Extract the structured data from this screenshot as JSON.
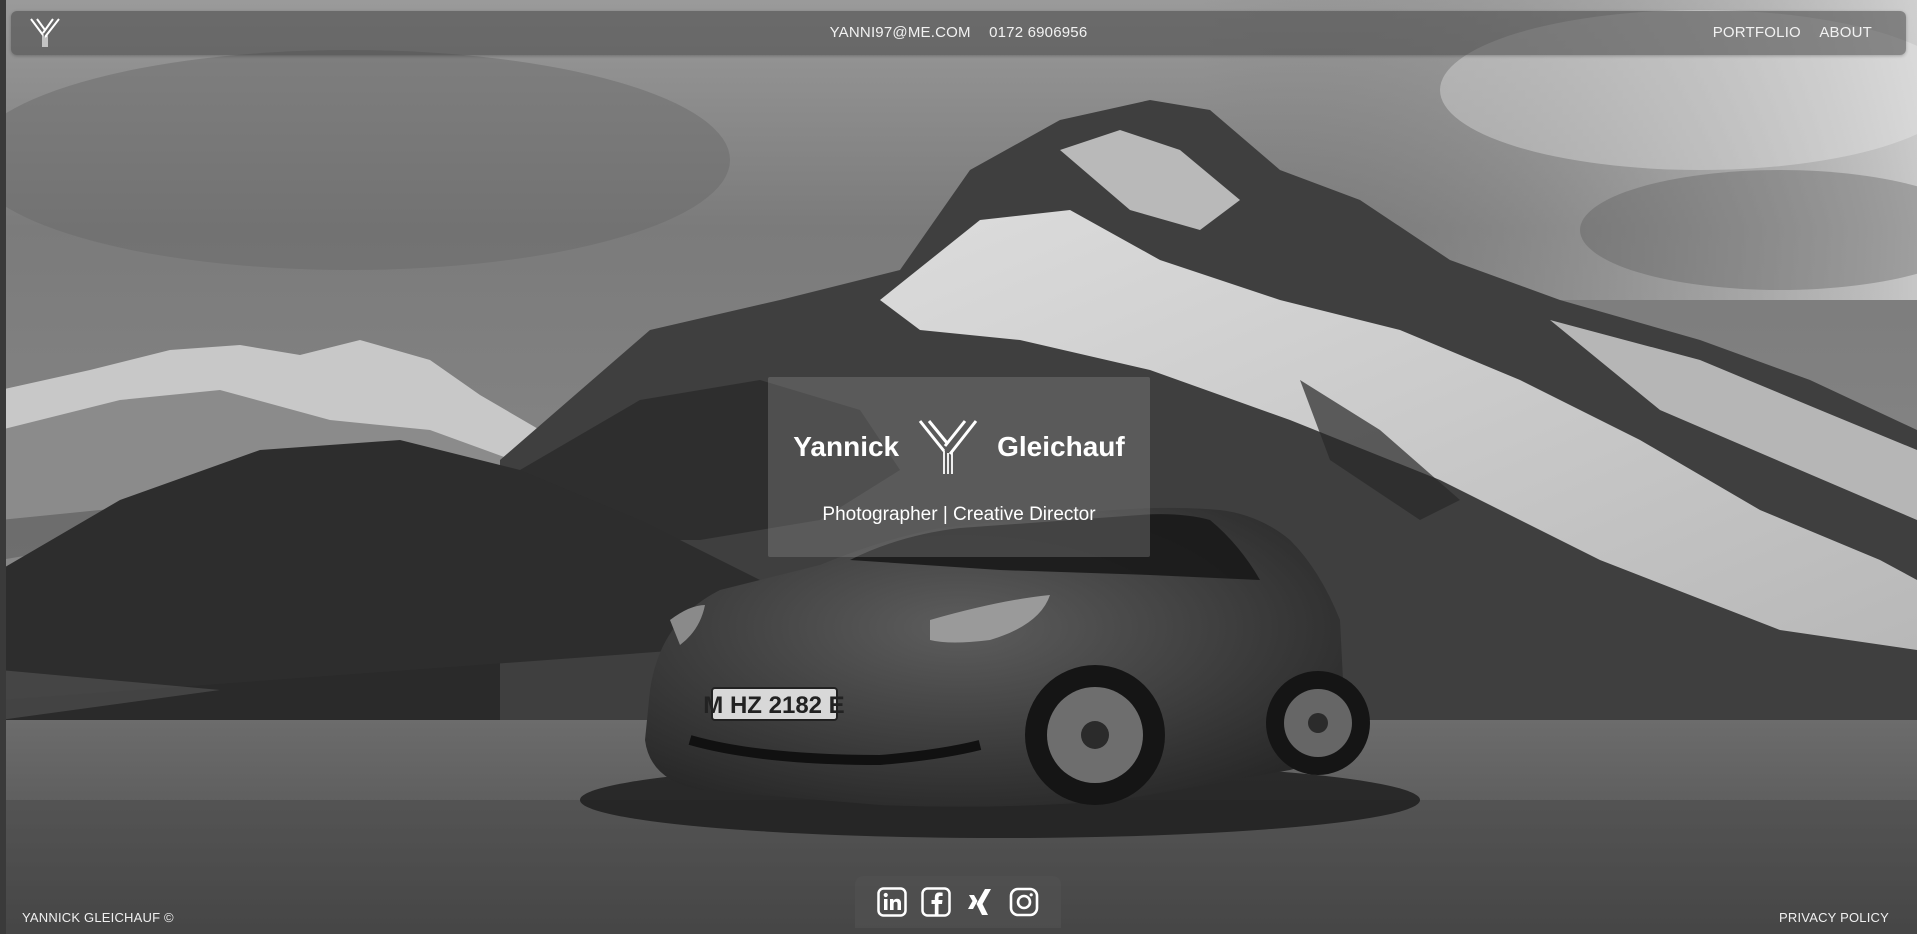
{
  "header": {
    "logo_icon": "y-monogram-logo-icon",
    "email": "YANNI97@ME.COM",
    "phone": "0172 6906956",
    "nav": [
      {
        "label": "PORTFOLIO"
      },
      {
        "label": "ABOUT"
      }
    ]
  },
  "hero": {
    "first_name": "Yannick",
    "last_name": "Gleichauf",
    "logo_icon": "y-monogram-logo-icon",
    "subtitle": "Photographer | Creative Director",
    "background": "black-and-white photo of a car in front of a snowy mountain"
  },
  "social": [
    {
      "icon": "linkedin-icon"
    },
    {
      "icon": "facebook-icon"
    },
    {
      "icon": "xing-icon"
    },
    {
      "icon": "instagram-icon"
    }
  ],
  "footer": {
    "copyright": "YANNICK GLEICHAUF ©",
    "privacy": "PRIVACY POLICY"
  },
  "colors": {
    "text": "#ffffff",
    "bar": "#464646"
  }
}
